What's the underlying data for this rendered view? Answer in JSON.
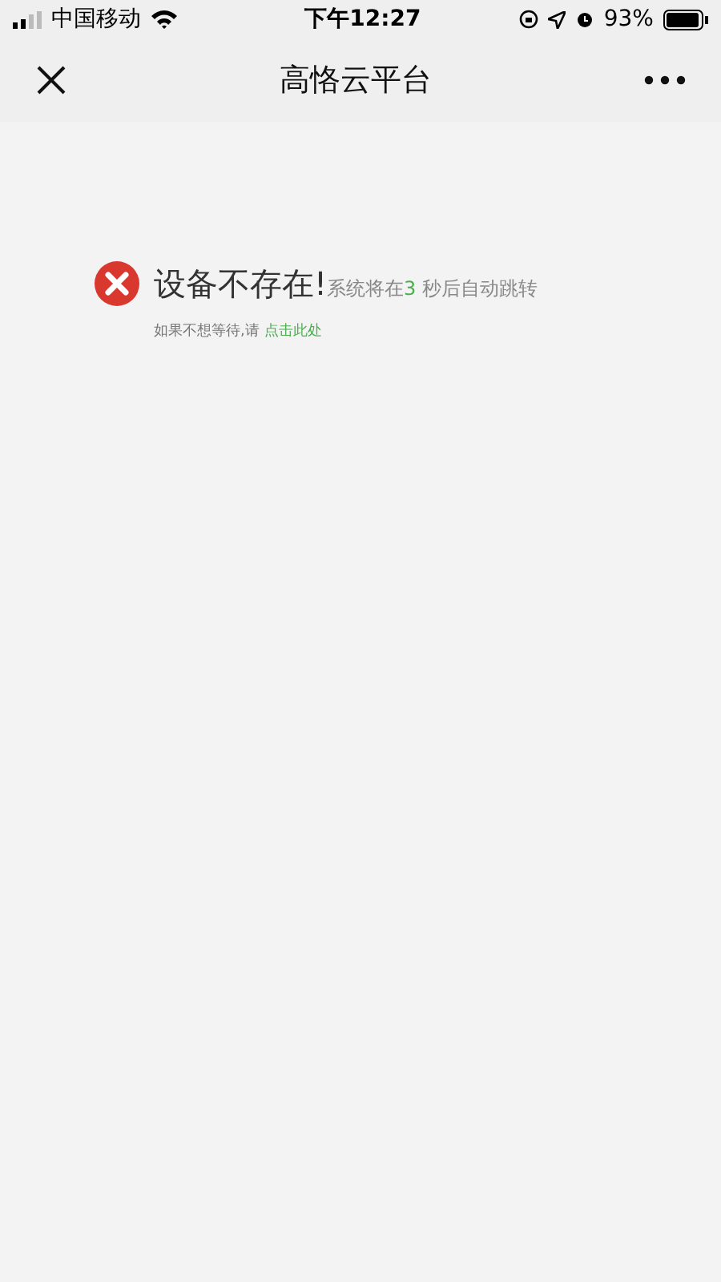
{
  "status_bar": {
    "carrier": "中国移动",
    "time": "下午12:27",
    "battery": "93%"
  },
  "nav": {
    "title": "高恪云平台"
  },
  "message": {
    "title": "设备不存在!",
    "countdown_before": "系统将在",
    "countdown_number": "3",
    "countdown_after": " 秒后自动跳转",
    "hint": "如果不想等待,请",
    "link": "点击此处"
  }
}
